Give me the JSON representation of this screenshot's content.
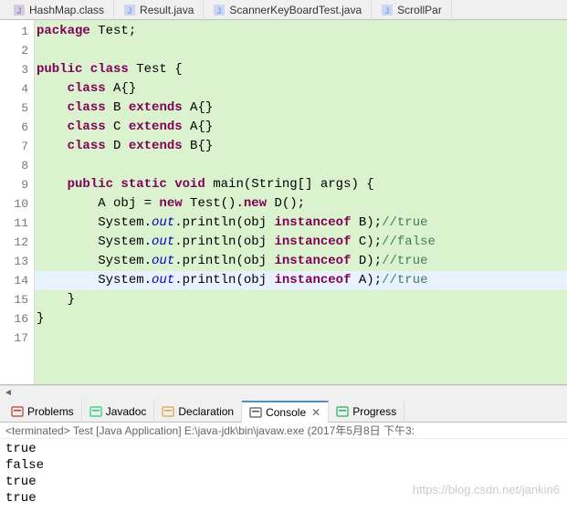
{
  "topTabs": [
    {
      "label": "HashMap.class",
      "iconColor": "#7b5cb0"
    },
    {
      "label": "Result.java",
      "iconColor": "#5b8def"
    },
    {
      "label": "ScannerKeyBoardTest.java",
      "iconColor": "#5b8def"
    },
    {
      "label": "ScrollPar",
      "iconColor": "#5b8def"
    }
  ],
  "code": {
    "lines": [
      {
        "n": 1,
        "segs": [
          {
            "t": "package",
            "c": "kw"
          },
          {
            "t": " Test;",
            "c": "plain"
          }
        ]
      },
      {
        "n": 2,
        "segs": []
      },
      {
        "n": 3,
        "segs": [
          {
            "t": "public class",
            "c": "kw"
          },
          {
            "t": " Test {",
            "c": "plain"
          }
        ]
      },
      {
        "n": 4,
        "segs": [
          {
            "t": "    ",
            "c": "plain"
          },
          {
            "t": "class",
            "c": "kw"
          },
          {
            "t": " A{}",
            "c": "plain"
          }
        ]
      },
      {
        "n": 5,
        "segs": [
          {
            "t": "    ",
            "c": "plain"
          },
          {
            "t": "class",
            "c": "kw"
          },
          {
            "t": " B ",
            "c": "plain"
          },
          {
            "t": "extends",
            "c": "kw"
          },
          {
            "t": " A{}",
            "c": "plain"
          }
        ]
      },
      {
        "n": 6,
        "segs": [
          {
            "t": "    ",
            "c": "plain"
          },
          {
            "t": "class",
            "c": "kw"
          },
          {
            "t": " C ",
            "c": "plain"
          },
          {
            "t": "extends",
            "c": "kw"
          },
          {
            "t": " A{}",
            "c": "plain"
          }
        ]
      },
      {
        "n": 7,
        "segs": [
          {
            "t": "    ",
            "c": "plain"
          },
          {
            "t": "class",
            "c": "kw"
          },
          {
            "t": " D ",
            "c": "plain"
          },
          {
            "t": "extends",
            "c": "kw"
          },
          {
            "t": " B{}",
            "c": "plain"
          }
        ]
      },
      {
        "n": 8,
        "segs": []
      },
      {
        "n": 9,
        "segs": [
          {
            "t": "    ",
            "c": "plain"
          },
          {
            "t": "public static void",
            "c": "kw"
          },
          {
            "t": " main(String[] args) {",
            "c": "plain"
          }
        ]
      },
      {
        "n": 10,
        "segs": [
          {
            "t": "        A obj = ",
            "c": "plain"
          },
          {
            "t": "new",
            "c": "kw"
          },
          {
            "t": " Test().",
            "c": "plain"
          },
          {
            "t": "new",
            "c": "kw"
          },
          {
            "t": " D();",
            "c": "plain"
          }
        ]
      },
      {
        "n": 11,
        "segs": [
          {
            "t": "        System.",
            "c": "plain"
          },
          {
            "t": "out",
            "c": "fld"
          },
          {
            "t": ".println(obj ",
            "c": "plain"
          },
          {
            "t": "instanceof",
            "c": "kw"
          },
          {
            "t": " B);",
            "c": "plain"
          },
          {
            "t": "//true",
            "c": "cmt"
          }
        ]
      },
      {
        "n": 12,
        "segs": [
          {
            "t": "        System.",
            "c": "plain"
          },
          {
            "t": "out",
            "c": "fld"
          },
          {
            "t": ".println(obj ",
            "c": "plain"
          },
          {
            "t": "instanceof",
            "c": "kw"
          },
          {
            "t": " C);",
            "c": "plain"
          },
          {
            "t": "//false",
            "c": "cmt"
          }
        ]
      },
      {
        "n": 13,
        "segs": [
          {
            "t": "        System.",
            "c": "plain"
          },
          {
            "t": "out",
            "c": "fld"
          },
          {
            "t": ".println(obj ",
            "c": "plain"
          },
          {
            "t": "instanceof",
            "c": "kw"
          },
          {
            "t": " D);",
            "c": "plain"
          },
          {
            "t": "//true",
            "c": "cmt"
          }
        ]
      },
      {
        "n": 14,
        "current": true,
        "segs": [
          {
            "t": "        System.",
            "c": "plain"
          },
          {
            "t": "out",
            "c": "fld"
          },
          {
            "t": ".println(obj ",
            "c": "plain"
          },
          {
            "t": "instanceof",
            "c": "kw"
          },
          {
            "t": " A);",
            "c": "plain"
          },
          {
            "t": "//true",
            "c": "cmt"
          }
        ]
      },
      {
        "n": 15,
        "segs": [
          {
            "t": "    }",
            "c": "plain"
          }
        ]
      },
      {
        "n": 16,
        "segs": [
          {
            "t": "}",
            "c": "plain"
          }
        ]
      },
      {
        "n": 17,
        "segs": []
      }
    ]
  },
  "bottomTabs": [
    {
      "label": "Problems",
      "iconColor": "#c0392b"
    },
    {
      "label": "Javadoc",
      "iconColor": "#2c7"
    },
    {
      "label": "Declaration",
      "iconColor": "#d9a441"
    },
    {
      "label": "Console",
      "iconColor": "#555",
      "active": true,
      "closable": true
    },
    {
      "label": "Progress",
      "iconColor": "#27ae60"
    }
  ],
  "console": {
    "status": "<terminated> Test [Java Application] E:\\java-jdk\\bin\\javaw.exe (2017年5月8日 下午3:",
    "lines": [
      "true",
      "false",
      "true",
      "true"
    ]
  },
  "watermark": "https://blog.csdn.net/jankin6"
}
